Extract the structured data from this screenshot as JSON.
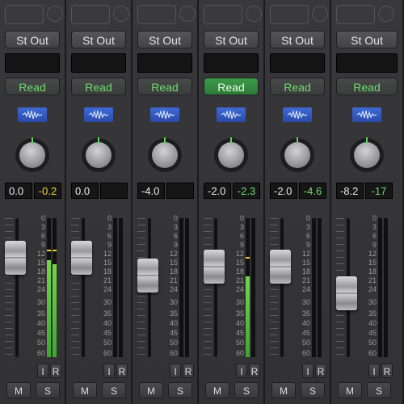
{
  "strips": [
    {
      "output": "St Out",
      "automation": "Read",
      "automation_active": false,
      "volume": "0.0",
      "peak": "-0.2",
      "peak_color": "#f0d23a",
      "fader_db": 0.0,
      "level_pct": [
        0.7,
        0.67
      ],
      "hold_pct": [
        0.76,
        0.76
      ],
      "input_label": "I",
      "record_label": "R",
      "mute_label": "M",
      "solo_label": "S",
      "show_ir": true
    },
    {
      "output": "St Out",
      "automation": "Read",
      "automation_active": false,
      "volume": "0.0",
      "peak": "",
      "peak_color": "#e8e8e8",
      "fader_db": 0.0,
      "level_pct": [
        0,
        0
      ],
      "hold_pct": [
        null,
        null
      ],
      "input_label": "I",
      "record_label": "R",
      "mute_label": "M",
      "solo_label": "S",
      "show_ir": true
    },
    {
      "output": "St Out",
      "automation": "Read",
      "automation_active": false,
      "volume": "-4.0",
      "peak": "",
      "peak_color": "#e8e8e8",
      "fader_db": -4.0,
      "level_pct": [
        0,
        0
      ],
      "hold_pct": [
        null,
        null
      ],
      "input_label": "I",
      "record_label": "R",
      "mute_label": "M",
      "solo_label": "S",
      "show_ir": true
    },
    {
      "output": "St Out",
      "automation": "Read",
      "automation_active": true,
      "volume": "-2.0",
      "peak": "-2.3",
      "peak_color": "#6fdc6f",
      "fader_db": -2.0,
      "level_pct": [
        0.58,
        0
      ],
      "hold_pct": [
        0.71,
        null
      ],
      "input_label": "I",
      "record_label": "R",
      "mute_label": "M",
      "solo_label": "S",
      "show_ir": true
    },
    {
      "output": "St Out",
      "automation": "Read",
      "automation_active": false,
      "volume": "-2.0",
      "peak": "-4.6",
      "peak_color": "#6fdc6f",
      "fader_db": -2.0,
      "level_pct": [
        0,
        0
      ],
      "hold_pct": [
        null,
        null
      ],
      "input_label": "I",
      "record_label": "R",
      "mute_label": "M",
      "solo_label": "S",
      "show_ir": true
    },
    {
      "output": "St Out",
      "automation": "Read",
      "automation_active": false,
      "volume": "-8.2",
      "peak": "-17",
      "peak_color": "#6fdc6f",
      "fader_db": -8.2,
      "level_pct": [
        0,
        0
      ],
      "hold_pct": [
        null,
        null
      ],
      "input_label": "I",
      "record_label": "R",
      "mute_label": "M",
      "solo_label": "S",
      "show_ir": true
    }
  ],
  "scale_labels": [
    "0",
    "3",
    "6",
    "9",
    "12",
    "15",
    "18",
    "21",
    "24",
    "30",
    "35",
    "40",
    "45",
    "50",
    "60"
  ],
  "icons": {
    "waveform": "waveform-icon",
    "pan_knob": "pan-knob"
  }
}
